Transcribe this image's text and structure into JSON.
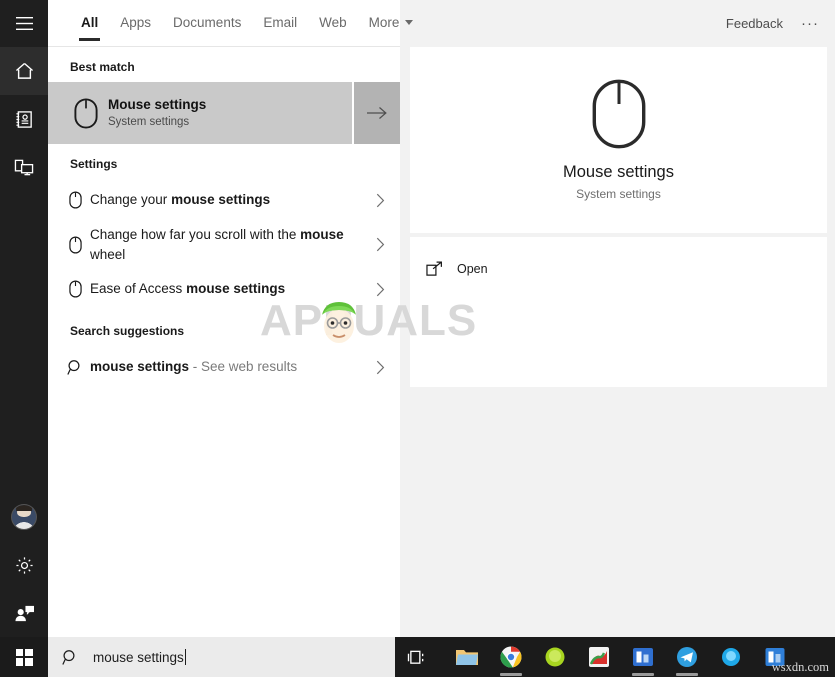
{
  "rail": {
    "items": [
      {
        "name": "hamburger",
        "icon": "hamburger-icon",
        "label": ""
      },
      {
        "name": "home",
        "icon": "home-icon",
        "label": ""
      },
      {
        "name": "notebook",
        "icon": "notebook-icon",
        "label": ""
      },
      {
        "name": "devices",
        "icon": "devices-icon",
        "label": ""
      }
    ],
    "bottom": [
      {
        "name": "account",
        "icon": "avatar-icon",
        "label": ""
      },
      {
        "name": "settings",
        "icon": "gear-icon",
        "label": ""
      },
      {
        "name": "feedback",
        "icon": "feedback-person-icon",
        "label": ""
      }
    ]
  },
  "topbar": {
    "tabs": [
      {
        "label": "All",
        "active": true
      },
      {
        "label": "Apps",
        "active": false
      },
      {
        "label": "Documents",
        "active": false
      },
      {
        "label": "Email",
        "active": false
      },
      {
        "label": "Web",
        "active": false
      },
      {
        "label": "More",
        "active": false,
        "caret": true
      }
    ],
    "feedback_label": "Feedback",
    "overflow_label": "···"
  },
  "results": {
    "best_match_header": "Best match",
    "best_match": {
      "title": "Mouse settings",
      "subtitle": "System settings",
      "icon": "mouse-icon",
      "arrow": "arrow-right-icon"
    },
    "settings_header": "Settings",
    "settings_items": [
      {
        "pre": "Change your ",
        "bold": "mouse settings",
        "post": "",
        "icon": "mouse-icon"
      },
      {
        "pre": "Change how far you scroll with the ",
        "bold": "mouse",
        "post": " wheel",
        "icon": "mouse-icon"
      },
      {
        "pre": "Ease of Access ",
        "bold": "mouse settings",
        "post": "",
        "icon": "mouse-icon"
      }
    ],
    "suggestions_header": "Search suggestions",
    "suggestions": [
      {
        "query": "mouse settings",
        "suffix": " - See web results",
        "icon": "search-icon"
      }
    ]
  },
  "preview": {
    "icon": "mouse-icon",
    "title": "Mouse settings",
    "subtitle": "System settings",
    "actions": [
      {
        "label": "Open",
        "icon": "open-external-icon"
      }
    ]
  },
  "watermark": {
    "text": "APPUALS",
    "bottom_right": "wsxdn.com"
  },
  "taskbar": {
    "start": "windows-logo-icon",
    "search_value": "mouse settings",
    "search_icon": "search-icon",
    "taskview_icon": "task-view-icon",
    "apps": [
      {
        "name": "file-explorer",
        "color": "#f0c060",
        "running": false
      },
      {
        "name": "google-chrome",
        "color": "#d8492f",
        "running": true
      },
      {
        "name": "green-app",
        "color": "#a5d21e",
        "running": false
      },
      {
        "name": "multicolor-app",
        "color": "#d84a4a",
        "running": false
      },
      {
        "name": "blue-white-app",
        "color": "#2f6fd0",
        "running": true
      },
      {
        "name": "telegram-app",
        "color": "#2f9fe0",
        "running": true
      },
      {
        "name": "cyan-glow-app",
        "color": "#1ea8e8",
        "running": false
      },
      {
        "name": "blue-square-app",
        "color": "#2f7fd8",
        "running": false
      }
    ]
  },
  "colors": {
    "rail_bg": "#1f1f1f",
    "panel_bg": "#ffffff",
    "preview_bg": "#f2f2f2",
    "best_row_bg": "#c9c9c9",
    "best_arrow_bg": "#b3b3b3",
    "taskbar_bg": "#1b1b1b",
    "searchbox_bg": "#ebebeb",
    "accent_text": "#1a1a1a",
    "muted_text": "#6e6e6e",
    "watermark": "#d8d8d8"
  }
}
